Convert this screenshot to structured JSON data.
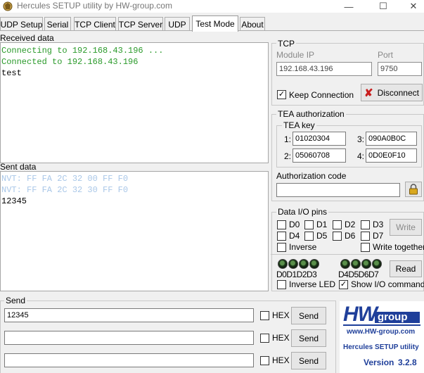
{
  "window": {
    "title": "Hercules SETUP utility by HW-group.com",
    "minimize_glyph": "—",
    "maximize_glyph": "☐",
    "close_glyph": "✕"
  },
  "tabs": [
    {
      "label": "UDP Setup",
      "active": false
    },
    {
      "label": "Serial",
      "active": false
    },
    {
      "label": "TCP Client",
      "active": false
    },
    {
      "label": "TCP Server",
      "active": false
    },
    {
      "label": "UDP",
      "active": false
    },
    {
      "label": "Test Mode",
      "active": true
    },
    {
      "label": "About",
      "active": false
    }
  ],
  "received": {
    "caption": "Received data",
    "lines": [
      {
        "text": "Connecting to 192.168.43.196 ...",
        "color": "#2a9a2a"
      },
      {
        "text": "Connected to 192.168.43.196",
        "color": "#2a9a2a"
      },
      {
        "text": "test",
        "color": "#000000"
      }
    ]
  },
  "sent": {
    "caption": "Sent data",
    "lines": [
      {
        "text": "NVT: FF FA 2C 32 00 FF F0",
        "color": "#a9c7e8"
      },
      {
        "text": "NVT: FF FA 2C 32 30 FF F0",
        "color": "#a9c7e8"
      },
      {
        "text": "12345",
        "color": "#000000"
      }
    ]
  },
  "tcp": {
    "group_label": "TCP",
    "module_ip_label": "Module IP",
    "module_ip_value": "192.168.43.196",
    "port_label": "Port",
    "port_value": "9750",
    "keep_connection_label": "Keep Connection",
    "keep_connection_checked": true,
    "disconnect_label": "Disconnect"
  },
  "tea": {
    "group_label": "TEA authorization",
    "key_label": "TEA key",
    "keys": [
      {
        "index": "1:",
        "value": "01020304"
      },
      {
        "index": "3:",
        "value": "090A0B0C"
      },
      {
        "index": "2:",
        "value": "05060708"
      },
      {
        "index": "4:",
        "value": "0D0E0F10"
      }
    ],
    "auth_code_label": "Authorization code",
    "auth_code_value": ""
  },
  "dio": {
    "group_label": "Data I/O pins",
    "pins_row1": [
      "D0",
      "D1",
      "D2",
      "D3"
    ],
    "pins_row2": [
      "D4",
      "D5",
      "D6",
      "D7"
    ],
    "write_label": "Write",
    "inverse_label": "Inverse",
    "write_together_label": "Write together",
    "led_labels_a": "D0D1D2D3",
    "led_labels_b": "D4D5D6D7",
    "read_label": "Read",
    "inverse_led_label": "Inverse LED",
    "show_io_label": "Show I/O commands",
    "show_io_checked": true
  },
  "send": {
    "group_label": "Send",
    "rows": [
      {
        "value": "12345",
        "hex_label": "HEX",
        "button_label": "Send"
      },
      {
        "value": "",
        "hex_label": "HEX",
        "button_label": "Send"
      },
      {
        "value": "",
        "hex_label": "HEX",
        "button_label": "Send"
      }
    ]
  },
  "logo": {
    "hw": "HW",
    "group": "group",
    "site": "www.HW-group.com",
    "product": "Hercules SETUP utility",
    "version_label": "Version",
    "version": "3.2.8",
    "brand_color": "#1f3f9a"
  }
}
